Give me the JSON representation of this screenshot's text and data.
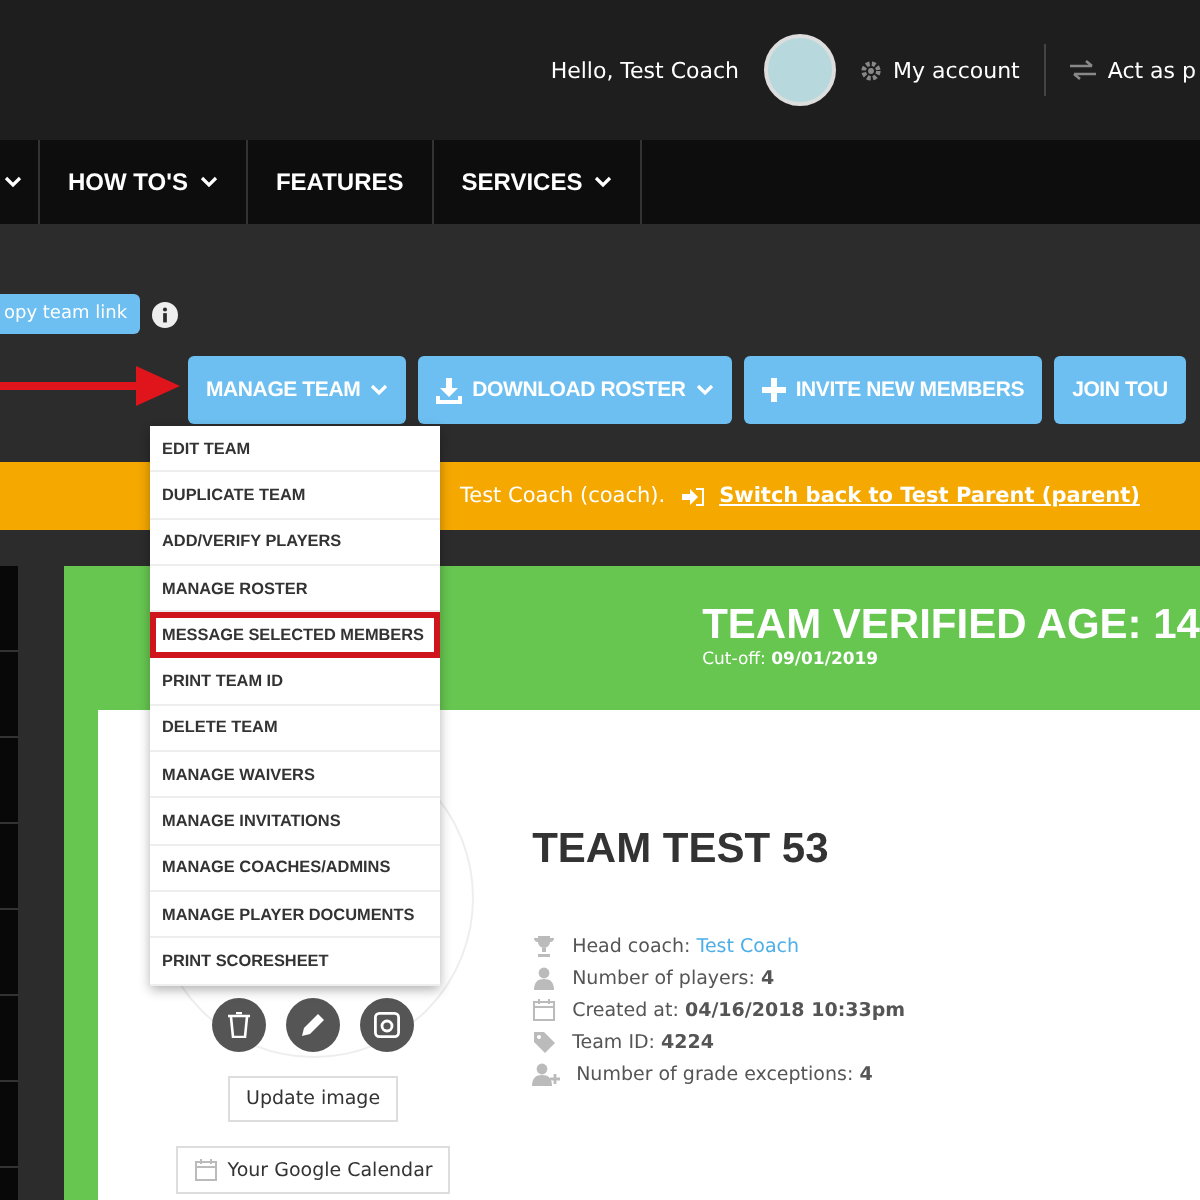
{
  "top_bar": {
    "greeting": "Hello, Test Coach",
    "account": "My account",
    "act_as": "Act as p"
  },
  "nav": [
    {
      "has_caret": true
    },
    {
      "label": "HOW TO'S",
      "has_caret": true
    },
    {
      "label": "FEATURES",
      "has_caret": false
    },
    {
      "label": "SERVICES",
      "has_caret": true
    }
  ],
  "copy_link": {
    "label": "opy team link"
  },
  "actions": [
    {
      "label": "MANAGE TEAM",
      "kind": "menu",
      "caret": true
    },
    {
      "label": "DOWNLOAD ROSTER",
      "kind": "download",
      "caret": true
    },
    {
      "label": "INVITE NEW MEMBERS",
      "kind": "invite",
      "caret": false
    },
    {
      "label": "JOIN TOU",
      "kind": "plain",
      "caret": false
    }
  ],
  "menu": [
    {
      "label": "EDIT TEAM",
      "highlighted": false
    },
    {
      "label": "DUPLICATE TEAM",
      "highlighted": false
    },
    {
      "label": "ADD/VERIFY PLAYERS",
      "highlighted": false
    },
    {
      "label": "MANAGE ROSTER",
      "highlighted": false
    },
    {
      "label": "MESSAGE SELECTED MEMBERS",
      "highlighted": true
    },
    {
      "label": "PRINT TEAM ID",
      "highlighted": false
    },
    {
      "label": "DELETE TEAM",
      "highlighted": false
    },
    {
      "label": "MANAGE WAIVERS",
      "highlighted": false
    },
    {
      "label": "MANAGE INVITATIONS",
      "highlighted": false
    },
    {
      "label": "MANAGE COACHES/ADMINS",
      "highlighted": false
    },
    {
      "label": "MANAGE PLAYER DOCUMENTS",
      "highlighted": false
    },
    {
      "label": "PRINT SCORESHEET",
      "highlighted": false
    }
  ],
  "banner": {
    "text": "Test Coach (coach).",
    "link": "Switch back to Test Parent (parent)"
  },
  "team": {
    "age_title": "TEAM VERIFIED AGE: 14",
    "cutoff_label": "Cut-off:",
    "cutoff": "09/01/2019",
    "name": "TEAM TEST 53",
    "update_image": "Update image",
    "calendar": "Your Google Calendar",
    "details": [
      {
        "kind": "coach",
        "label": "Head coach:",
        "value": "Test Coach"
      },
      {
        "kind": "players",
        "label": "Number of players:",
        "value": "4"
      },
      {
        "kind": "created",
        "label": "Created at:",
        "value": "04/16/2018 10:33pm"
      },
      {
        "kind": "id",
        "label": "Team ID:",
        "value": "4224"
      },
      {
        "kind": "exceptions",
        "label": "Number of grade exceptions:",
        "value": "4"
      }
    ]
  }
}
